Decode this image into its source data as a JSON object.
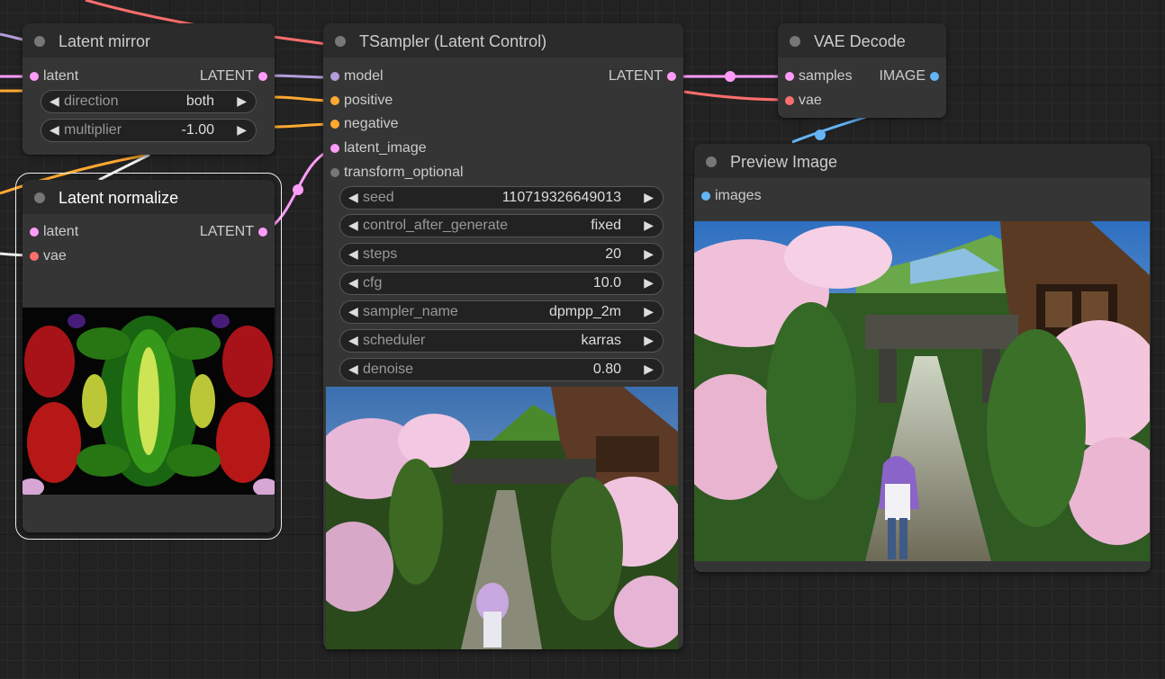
{
  "colors": {
    "latent": "#ff9cf9",
    "model": "#b39ddb",
    "conditioning": "#ffa931",
    "vae": "#ff6e6e",
    "image": "#64b5f6",
    "optional": "#777777"
  },
  "latent_mirror": {
    "title": "Latent mirror",
    "input_latent": "latent",
    "output_latent": "LATENT",
    "direction": {
      "name": "direction",
      "value": "both"
    },
    "multiplier": {
      "name": "multiplier",
      "value": "-1.00"
    }
  },
  "latent_normalize": {
    "title": "Latent normalize",
    "input_latent": "latent",
    "input_vae": "vae",
    "output_latent": "LATENT",
    "preview_icon": "abstract-latent-preview"
  },
  "tsampler": {
    "title": "TSampler (Latent Control)",
    "inputs": [
      "model",
      "positive",
      "negative",
      "latent_image",
      "transform_optional"
    ],
    "output_latent": "LATENT",
    "widgets": [
      {
        "name": "seed",
        "value": "110719326649013"
      },
      {
        "name": "control_after_generate",
        "value": "fixed"
      },
      {
        "name": "steps",
        "value": "20"
      },
      {
        "name": "cfg",
        "value": "10.0"
      },
      {
        "name": "sampler_name",
        "value": "dpmpp_2m"
      },
      {
        "name": "scheduler",
        "value": "karras"
      },
      {
        "name": "denoise",
        "value": "0.80"
      }
    ],
    "preview_icon": "sampler-output-preview"
  },
  "vae_decode": {
    "title": "VAE Decode",
    "input_samples": "samples",
    "input_vae": "vae",
    "output_image": "IMAGE"
  },
  "preview_image": {
    "title": "Preview Image",
    "input_images": "images",
    "preview_icon": "decoded-image-preview"
  }
}
